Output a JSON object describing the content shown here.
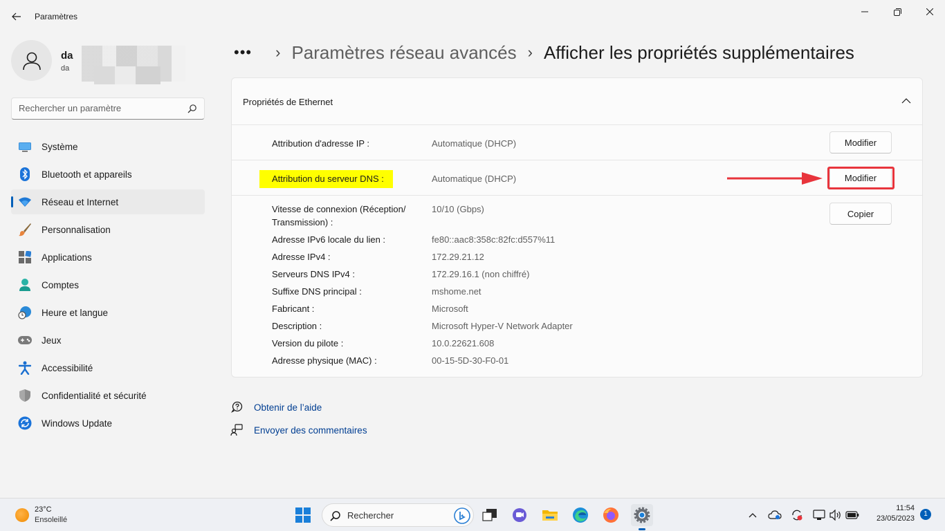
{
  "window": {
    "title": "Paramètres"
  },
  "profile": {
    "name": "da",
    "email": "da"
  },
  "search": {
    "placeholder": "Rechercher un paramètre"
  },
  "sidebar": {
    "items": [
      {
        "label": "Système",
        "icon": "system-icon"
      },
      {
        "label": "Bluetooth et appareils",
        "icon": "bluetooth-icon"
      },
      {
        "label": "Réseau et Internet",
        "icon": "wifi-icon",
        "active": true
      },
      {
        "label": "Personnalisation",
        "icon": "brush-icon"
      },
      {
        "label": "Applications",
        "icon": "apps-icon"
      },
      {
        "label": "Comptes",
        "icon": "account-icon"
      },
      {
        "label": "Heure et langue",
        "icon": "globe-clock-icon"
      },
      {
        "label": "Jeux",
        "icon": "gamepad-icon"
      },
      {
        "label": "Accessibilité",
        "icon": "accessibility-icon"
      },
      {
        "label": "Confidentialité et sécurité",
        "icon": "shield-icon"
      },
      {
        "label": "Windows Update",
        "icon": "update-icon"
      }
    ]
  },
  "breadcrumb": {
    "dots": "•••",
    "parent": "Paramètres réseau avancés",
    "current": "Afficher les propriétés supplémentaires"
  },
  "card": {
    "title": "Propriétés de Ethernet",
    "ip_row": {
      "label": "Attribution d'adresse IP :",
      "value": "Automatique (DHCP)",
      "button": "Modifier"
    },
    "dns_row": {
      "label": "Attribution du serveur DNS :",
      "value": "Automatique (DHCP)",
      "button": "Modifier"
    },
    "copy_button": "Copier",
    "properties": [
      {
        "label": "Vitesse de connexion (Réception/ Transmission) :",
        "value": "10/10 (Gbps)"
      },
      {
        "label": "Adresse IPv6 locale du lien :",
        "value": "fe80::aac8:358c:82fc:d557%11"
      },
      {
        "label": "Adresse IPv4 :",
        "value": "172.29.21.12"
      },
      {
        "label": "Serveurs DNS IPv4 :",
        "value": "172.29.16.1 (non chiffré)"
      },
      {
        "label": "Suffixe DNS principal :",
        "value": "mshome.net"
      },
      {
        "label": "Fabricant :",
        "value": "Microsoft"
      },
      {
        "label": "Description :",
        "value": "Microsoft Hyper-V Network Adapter"
      },
      {
        "label": "Version du pilote :",
        "value": "10.0.22621.608"
      },
      {
        "label": "Adresse physique (MAC) :",
        "value": "00-15-5D-30-F0-01"
      }
    ]
  },
  "help": {
    "get_help": "Obtenir de l’aide",
    "feedback": "Envoyer des commentaires"
  },
  "taskbar": {
    "temperature": "23°C",
    "weather": "Ensoleillé",
    "search_label": "Rechercher",
    "time": "11:54",
    "date": "23/05/2023",
    "notifications": "1"
  },
  "colors": {
    "accent": "#005fb8",
    "highlight": "#ffff00",
    "annotation_red": "#e8343c"
  }
}
